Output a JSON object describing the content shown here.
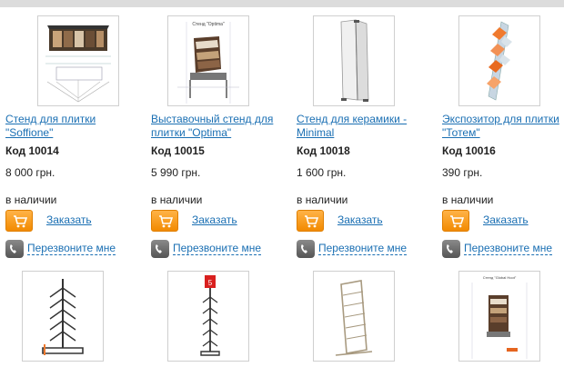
{
  "products": [
    {
      "title": "Стенд для плитки \"Soffione\"",
      "code": "Код 10014",
      "price": "8 000 грн.",
      "availability": "в наличии",
      "order_label": "Заказать",
      "callback_label": "Перезвоните мне"
    },
    {
      "title": "Выставочный стенд для плитки \"Optima\"",
      "code": "Код 10015",
      "price": "5 990 грн.",
      "availability": "в наличии",
      "order_label": "Заказать",
      "callback_label": "Перезвоните мне",
      "thumb_caption": "Стенд \"Optima\""
    },
    {
      "title": "Стенд для керамики - Minimal",
      "code": "Код 10018",
      "price": "1 600 грн.",
      "availability": "в наличии",
      "order_label": "Заказать",
      "callback_label": "Перезвоните мне"
    },
    {
      "title": "Экспозитор для плитки \"Тотем\"",
      "code": "Код 10016",
      "price": "390 грн.",
      "availability": "в наличии",
      "order_label": "Заказать",
      "callback_label": "Перезвоните мне"
    }
  ],
  "second_row": {
    "card_2_logo": "5",
    "card_4_caption": "Стенд \"Global Hoot\""
  },
  "colors": {
    "link": "#1a6fb3",
    "cart_button": "#f28a00",
    "top_bar": "#dcdcdc"
  },
  "icons": {
    "cart": "cart-icon",
    "phone": "phone-icon"
  }
}
